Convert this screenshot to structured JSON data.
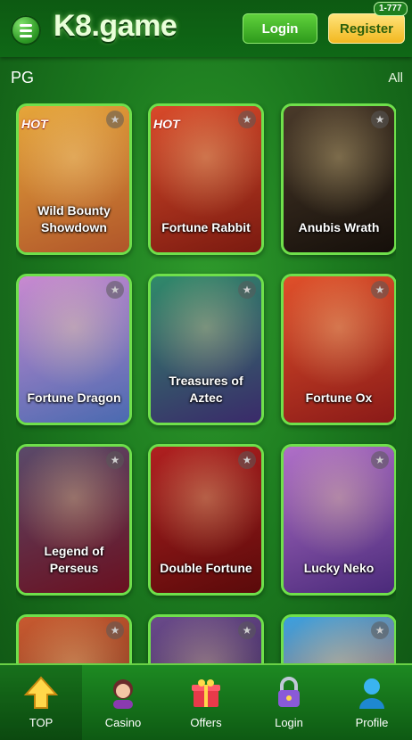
{
  "header": {
    "logo": "K8.game",
    "login_label": "Login",
    "register_label": "Register",
    "badge": "1-777"
  },
  "section": {
    "title": "PG",
    "all_label": "All"
  },
  "games": [
    {
      "name": "Wild Bounty Showdown",
      "hot": true,
      "hot_label": "HOT",
      "colors": [
        "#e6a63a",
        "#b0552a"
      ]
    },
    {
      "name": "Fortune Rabbit",
      "hot": true,
      "hot_label": "HOT",
      "colors": [
        "#d94a2a",
        "#7a1a10"
      ]
    },
    {
      "name": "Anubis Wrath",
      "hot": false,
      "colors": [
        "#4a3a2a",
        "#150f0a"
      ]
    },
    {
      "name": "Fortune Dragon",
      "hot": false,
      "colors": [
        "#c98ad0",
        "#4a6ab0"
      ]
    },
    {
      "name": "Treasures of Aztec",
      "hot": false,
      "colors": [
        "#2f8a6a",
        "#3a2a6a"
      ]
    },
    {
      "name": "Fortune Ox",
      "hot": false,
      "colors": [
        "#e0502a",
        "#8a1a18"
      ]
    },
    {
      "name": "Legend of Perseus",
      "hot": false,
      "colors": [
        "#5a4a6a",
        "#6a1020"
      ]
    },
    {
      "name": "Double Fortune",
      "hot": false,
      "colors": [
        "#b02020",
        "#5a0a0a"
      ]
    },
    {
      "name": "Lucky Neko",
      "hot": false,
      "colors": [
        "#b070c8",
        "#4a2a7a"
      ]
    },
    {
      "name": "",
      "hot": false,
      "colors": [
        "#c85a30",
        "#6a2a18"
      ]
    },
    {
      "name": "",
      "hot": false,
      "colors": [
        "#6a4a8a",
        "#2a1a4a"
      ]
    },
    {
      "name": "",
      "hot": false,
      "colors": [
        "#3aa0e0",
        "#e05a2a"
      ]
    }
  ],
  "nav": [
    {
      "label": "TOP",
      "icon": "top-arrow-icon",
      "active": true
    },
    {
      "label": "Casino",
      "icon": "casino-girl-icon",
      "active": false
    },
    {
      "label": "Offers",
      "icon": "gift-icon",
      "active": false
    },
    {
      "label": "Login",
      "icon": "lock-icon",
      "active": false
    },
    {
      "label": "Profile",
      "icon": "profile-icon",
      "active": false
    }
  ]
}
